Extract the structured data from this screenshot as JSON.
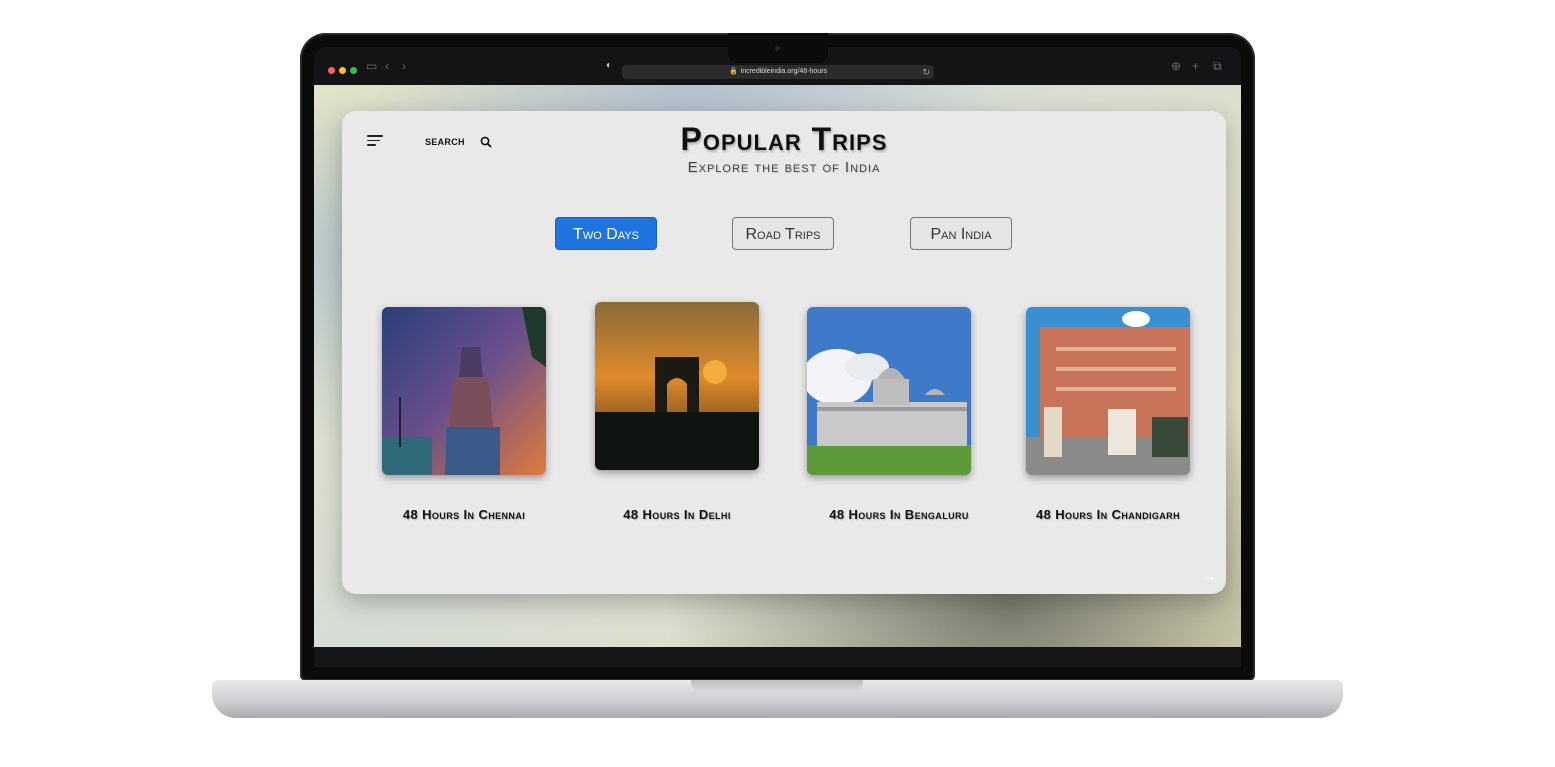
{
  "browser": {
    "url": "incredibleindia.org/48-hours",
    "icons": {
      "sidebar": "sidebar-icon",
      "back": "chevron-left-icon",
      "forward": "chevron-right-icon",
      "shield": "shield-icon",
      "reload": "reload-icon",
      "download": "download-icon",
      "new_tab": "plus-icon",
      "tabs": "tabs-overview-icon"
    }
  },
  "header": {
    "search_label": "SEARCH",
    "title": "Popular Trips",
    "subtitle": "Explore the best of India"
  },
  "tabs": [
    {
      "label": "Two Days",
      "active": true
    },
    {
      "label": "Road Trips",
      "active": false
    },
    {
      "label": "Pan India",
      "active": false
    }
  ],
  "destinations": [
    {
      "label": "48 Hours In Chennai"
    },
    {
      "label": "48 Hours In Delhi"
    },
    {
      "label": "48 Hours In Bengaluru"
    },
    {
      "label": "48 Hours In Chandigarh"
    }
  ],
  "colors": {
    "accent": "#1f74df",
    "card_bg": "#e9e9ea"
  }
}
